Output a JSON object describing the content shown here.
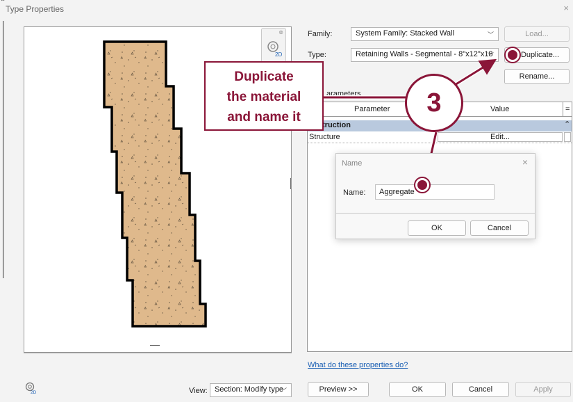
{
  "window": {
    "title": "Type Properties",
    "close": "×"
  },
  "family": {
    "label": "Family:",
    "value": "System Family: Stacked Wall",
    "load_label": "Load..."
  },
  "type": {
    "label": "Type:",
    "value": "Retaining Walls - Segmental - 8\"x12\"x18",
    "duplicate_label": "Duplicate...",
    "rename_label": "Rename..."
  },
  "params": {
    "section_label": "arameters",
    "col_parameter": "Parameter",
    "col_value": "Value",
    "col_eq": "=",
    "group_label": "truction",
    "collapse": "⌃",
    "rows": [
      {
        "name": "Structure",
        "value": "Edit..."
      }
    ]
  },
  "callout": {
    "line1": "Duplicate",
    "line2": "the material",
    "line3": "and name it"
  },
  "step": {
    "number": "3"
  },
  "dialog": {
    "title": "Name",
    "close": "×",
    "name_label": "Name:",
    "name_value": "Aggregate",
    "ok": "OK",
    "cancel": "Cancel"
  },
  "help_link": "What do these properties do?",
  "footer": {
    "view_label": "View:",
    "view_value": "Section: Modify type",
    "preview": "Preview >>",
    "ok": "OK",
    "cancel": "Cancel",
    "apply": "Apply"
  },
  "colors": {
    "accent": "#8a1538",
    "wall_fill": "#dfb98c",
    "group_row": "#b9c9de"
  },
  "icons": {
    "view_cube": "view-cube-2d-icon",
    "small_2d": "2d-view-icon"
  }
}
